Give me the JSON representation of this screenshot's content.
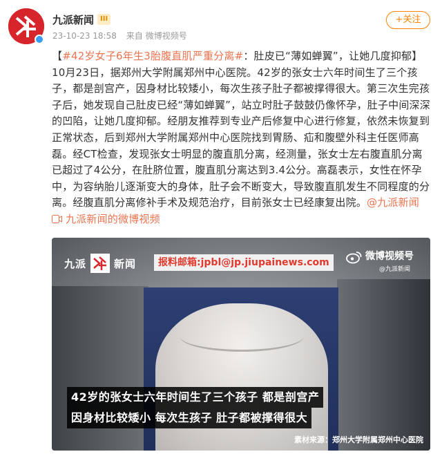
{
  "colors": {
    "brand_red": "#d7262b",
    "follow_orange": "#ff8200",
    "link_orange": "#eb7350",
    "verify_blue": "#3b9df0"
  },
  "post": {
    "author": "九派新闻",
    "vip_badge": "III",
    "timestamp": "23-10-23 18:58",
    "source_prefix": "来自",
    "source": "微博视频号",
    "follow_label": "+关注",
    "text_open": "【",
    "topic": "#42岁女子6年生3胎腹直肌严重分离#",
    "body": "：肚皮已“薄如蝉翼”，让她几度抑郁】10月23日，据郑州大学附属郑州中心医院。42岁的张女士六年时间生了三个孩子，都是剖宫产，因身材比较矮小，每次生孩子肚子都被撑得很大。第三次生完孩子后，她发现自己肚皮已经“薄如蝉翼”，站立时肚子鼓鼓仍像怀孕，肚子中间深深的凹陷，让她几度抑郁。经朋友推荐到专业产后修复中心进行修复，依然未恢复到正常状态，后到郑州大学附属郑州中心医院找到胃肠、疝和腹壁外科主任医师高磊。经CT检查，发现张女士明显的腹直肌分离，经测量，张女士左右腹直肌分离已超过了4公分，在肚脐位置，腹直肌分离达到3.4公分。高磊表示，女性在怀孕中，为容纳胎儿逐渐变大的身体，肚子会不断变大，导致腹直肌发生不同程度的分离。经腹直肌分离修补手术及规范治疗，目前张女士已经康复出院。",
    "mention": "@九派新闻",
    "video_link_icon": "video-link-icon",
    "video_link": "九派新闻的微博视频"
  },
  "video": {
    "logo_left": "九派",
    "logo_right": "新闻",
    "email": "报料邮箱:jpbl@jp.jiupainews.com",
    "brand_name": "微博视频号",
    "brand_sub": "@九派新闻",
    "subtitle_line1": "42岁的张女士六年时间生了三个孩子 都是剖宫产",
    "subtitle_line2": "因身材比较矮小 每次生孩子 肚子都被撑得很大",
    "footer_source": "素材来源：郑州大学附属郑州中心医院"
  }
}
